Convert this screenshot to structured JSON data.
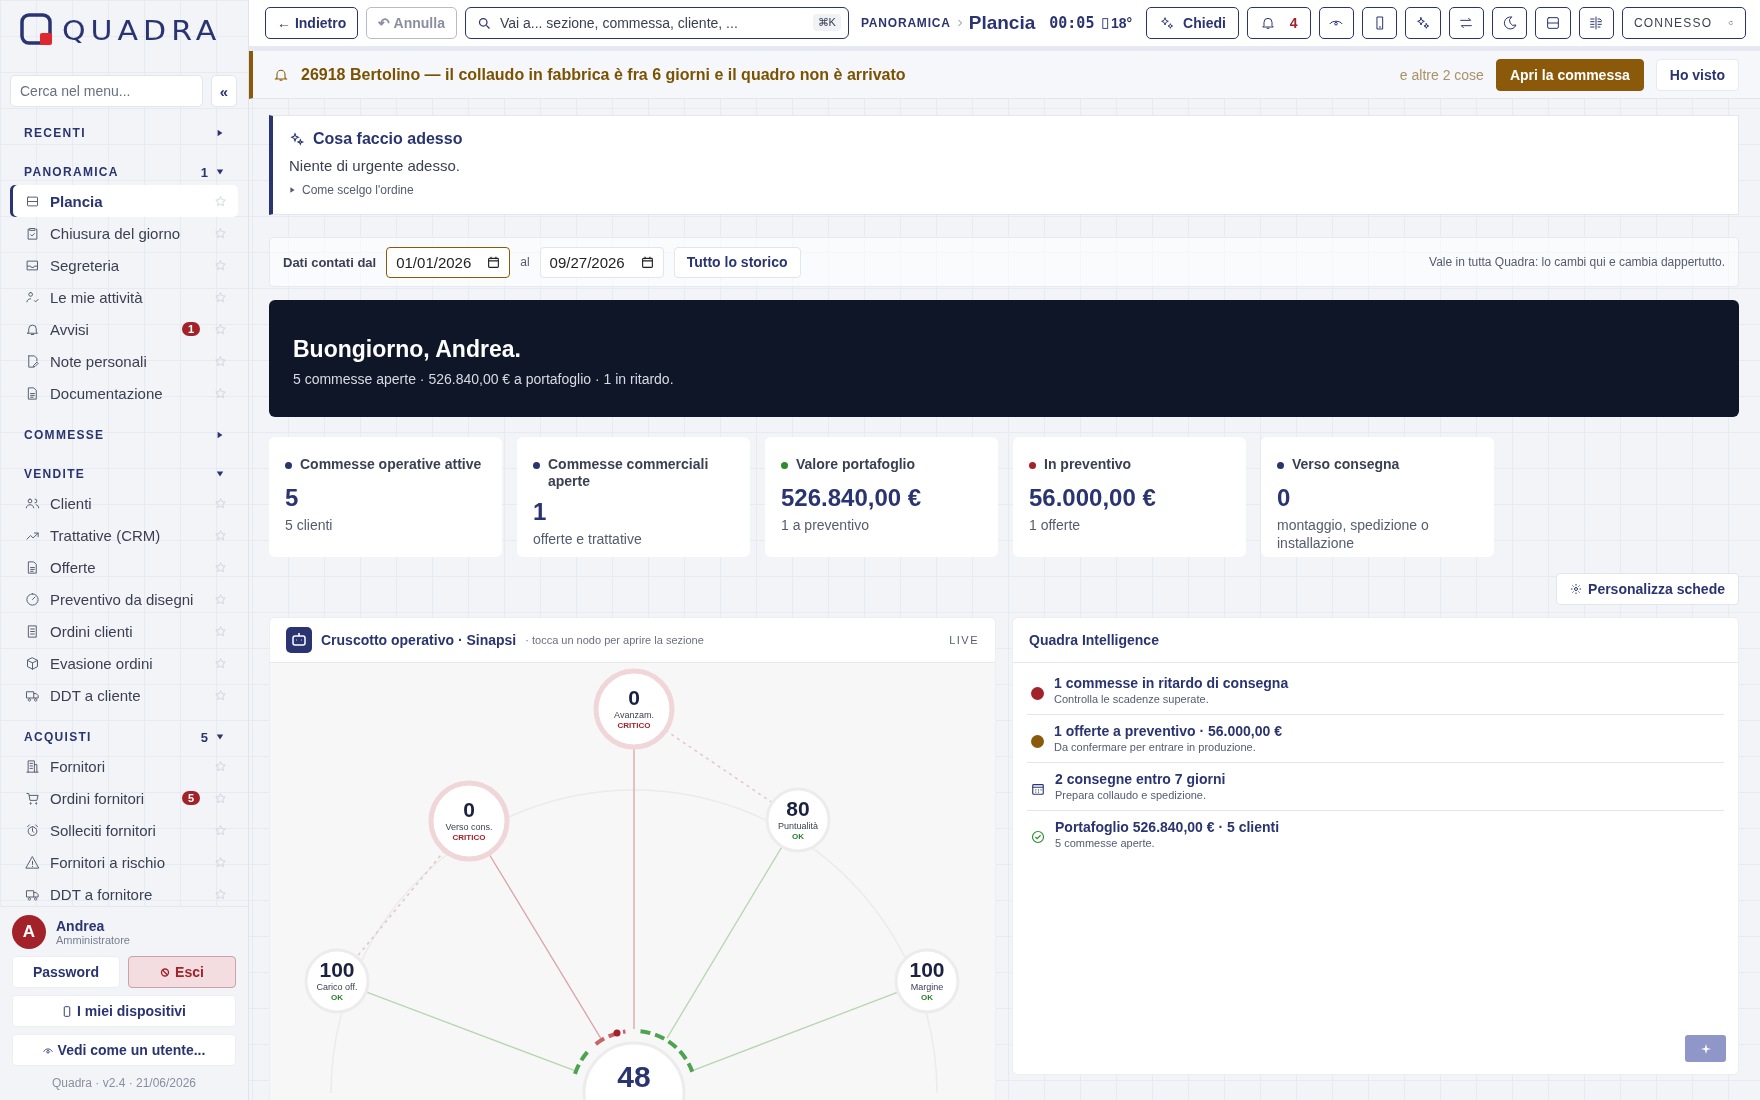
{
  "sidebar": {
    "logo": "QUADRA",
    "search": {
      "placeholder": "Cerca nel menu..."
    },
    "collapse_button": "«",
    "groups": [
      {
        "title": "RECENTI",
        "expanded": false
      },
      {
        "title": "PANORAMICA",
        "count": "1",
        "expanded": true,
        "items": [
          {
            "label": "Plancia",
            "selected": true
          },
          {
            "label": "Chiusura del giorno",
            "selected": false
          },
          {
            "label": "Segreteria",
            "selected": false
          },
          {
            "label": "Le mie attività",
            "selected": false
          },
          {
            "label": "Avvisi",
            "selected": false,
            "badge": "1"
          },
          {
            "label": "Note personali",
            "selected": false
          },
          {
            "label": "Documentazione",
            "selected": false
          }
        ]
      },
      {
        "title": "COMMESSE",
        "expanded": false
      },
      {
        "title": "VENDITE",
        "expanded": true,
        "items": [
          {
            "label": "Clienti",
            "selected": false
          },
          {
            "label": "Trattative (CRM)",
            "selected": false
          },
          {
            "label": "Offerte",
            "selected": false
          },
          {
            "label": "Preventivo da disegni",
            "selected": false
          },
          {
            "label": "Ordini clienti",
            "selected": false
          },
          {
            "label": "Evasione ordini",
            "selected": false
          },
          {
            "label": "DDT a cliente",
            "selected": false
          }
        ]
      },
      {
        "title": "ACQUISTI",
        "count": "5",
        "expanded": true,
        "items": [
          {
            "label": "Fornitori",
            "selected": false
          },
          {
            "label": "Ordini fornitori",
            "selected": false,
            "badge": "5"
          },
          {
            "label": "Solleciti fornitori",
            "selected": false
          },
          {
            "label": "Fornitori a rischio",
            "selected": false
          },
          {
            "label": "DDT a fornitore",
            "selected": false
          }
        ]
      }
    ],
    "user": {
      "initial": "A",
      "name": "Andrea",
      "role": "Amministratore"
    },
    "buttons": {
      "password": "Password",
      "logout": "Esci",
      "devices": "I miei dispositivi",
      "impersonate": "Vedi come un utente..."
    },
    "version": "Quadra · v2.4 · 21/06/2026"
  },
  "topbar": {
    "back": "← Indietro",
    "undo": {
      "label": "↶ Annulla",
      "disabled": true
    },
    "search": {
      "placeholder": "Vai a... sezione, commessa, cliente, ...",
      "shortcut": "⌘K"
    },
    "breadcrumb": {
      "section": "PANORAMICA",
      "page": "Plancia"
    },
    "clock": "00:05",
    "temperature": "18°",
    "ask": "Chiedi",
    "notifications": "4",
    "status": "CONNESSO"
  },
  "alert": {
    "text": "26918 Bertolino — il collaudo in fabbrica è fra 6 giorni e il quadro non è arrivato",
    "more": "e altre 2 cose",
    "primary": "Apri la commessa",
    "secondary": "Ho visto"
  },
  "next_action": {
    "title": "Cosa faccio adesso",
    "text": "Niente di urgente adesso.",
    "disclosure": "Come scelgo l'ordine"
  },
  "date_range": {
    "label": "Dati contati dal",
    "from": "01/01/2026",
    "separator": "al",
    "to": "09/27/2026",
    "all_button": "Tutto lo storico",
    "note": "Vale in tutta Quadra: lo cambi qui e cambia dappertutto."
  },
  "hero": {
    "title": "Buongiorno, Andrea.",
    "subtitle": "5 commesse aperte · 526.840,00 € a portafoglio · 1 in ritardo."
  },
  "kpis": [
    {
      "label": "Commesse operative attive",
      "color": "#2a3470",
      "value": "5",
      "sub": "5 clienti"
    },
    {
      "label": "Commesse commerciali aperte",
      "color": "#2a3470",
      "value": "1",
      "sub": "offerte e trattative"
    },
    {
      "label": "Valore portafoglio",
      "color": "#2e8b2e",
      "value": "526.840,00 €",
      "sub": "1 a preventivo"
    },
    {
      "label": "In preventivo",
      "color": "#a3222a",
      "value": "56.000,00 €",
      "sub": "1 offerte"
    },
    {
      "label": "Verso consegna",
      "color": "#2a3470",
      "value": "0",
      "sub": "montaggio, spedizione o installazione"
    }
  ],
  "customize_button": "Personalizza schede",
  "cockpit": {
    "title": "Cruscotto operativo · Sinapsi",
    "hint": "· tocca un nodo per aprire la sezione",
    "live": "LIVE",
    "nodes": [
      {
        "value": "0",
        "label": "Avanzam.",
        "status": "CRITICO",
        "kind": "critical"
      },
      {
        "value": "0",
        "label": "Verso cons.",
        "status": "CRITICO",
        "kind": "critical"
      },
      {
        "value": "80",
        "label": "Puntualità",
        "status": "OK",
        "kind": "ok"
      },
      {
        "value": "100",
        "label": "Carico off.",
        "status": "OK",
        "kind": "ok"
      },
      {
        "value": "100",
        "label": "Margine",
        "status": "OK",
        "kind": "ok"
      }
    ],
    "center": {
      "value": "48"
    }
  },
  "intelligence": {
    "title": "Quadra Intelligence",
    "items": [
      {
        "kind": "dot",
        "color": "#a3222a",
        "title": "1 commesse in ritardo di consegna",
        "sub": "Controlla le scadenze superate."
      },
      {
        "kind": "dot",
        "color": "#8a5a0a",
        "title": "1 offerte a preventivo · 56.000,00 €",
        "sub": "Da confermare per entrare in produzione."
      },
      {
        "kind": "calendar",
        "title": "2 consegne entro 7 giorni",
        "sub": "Prepara collaudo e spedizione."
      },
      {
        "kind": "check",
        "title": "Portafoglio 526.840,00 € · 5 clienti",
        "sub": "5 commesse aperte."
      }
    ]
  }
}
